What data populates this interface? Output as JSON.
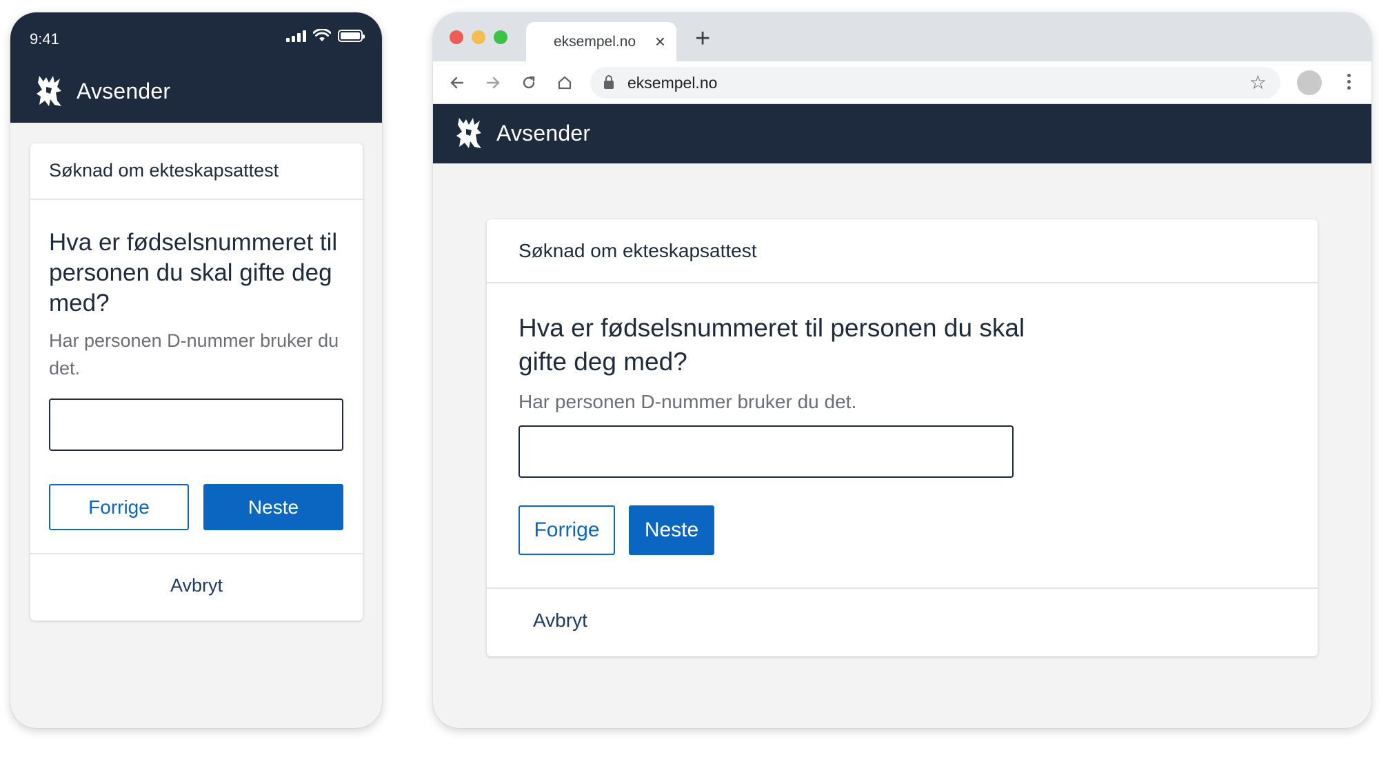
{
  "phone": {
    "status": {
      "time": "9:41"
    },
    "header": {
      "title": "Avsender"
    },
    "form": {
      "form_title": "Søknad om ekteskapsattest",
      "question": "Hva er fødselsnummeret til personen du skal gifte deg med?",
      "hint": "Har personen D-nummer bruker du det.",
      "input_value": "",
      "prev_label": "Forrige",
      "next_label": "Neste",
      "cancel_label": "Avbryt"
    }
  },
  "browser": {
    "tab": {
      "title": "eksempel.no",
      "close": "×",
      "new_tab": "+"
    },
    "address_bar": {
      "url": "eksempel.no"
    },
    "header": {
      "title": "Avsender"
    },
    "form": {
      "form_title": "Søknad om ekteskapsattest",
      "question": "Hva er fødselsnummeret til personen du skal gifte deg med?",
      "hint": "Har personen D-nummer bruker du det.",
      "input_value": "",
      "prev_label": "Forrige",
      "next_label": "Neste",
      "cancel_label": "Avbryt"
    }
  },
  "colors": {
    "header_bg": "#1e2a3d",
    "primary": "#0b66c1",
    "page_bg": "#f3f3f4",
    "traffic_red": "#ee5c56",
    "traffic_yellow": "#f5bd4f",
    "traffic_green": "#3dc248"
  },
  "icons": {
    "logo": "norwegian-coat-of-arms-icon",
    "back": "arrow-left-icon",
    "forward": "arrow-right-icon",
    "reload": "reload-icon",
    "home": "home-icon",
    "lock": "lock-icon",
    "bookmark": "star-icon",
    "menu": "kebab-menu-icon"
  }
}
